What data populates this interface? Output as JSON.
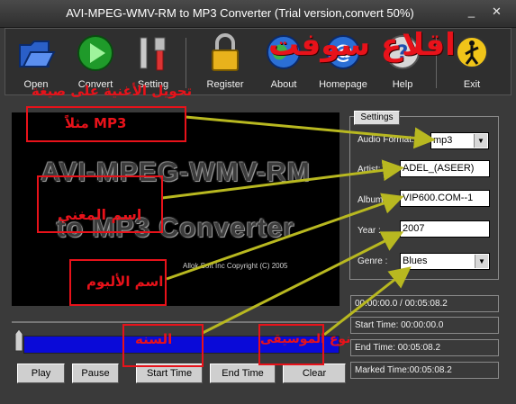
{
  "window": {
    "title": "AVI-MPEG-WMV-RM to MP3 Converter (Trial version,convert 50%)",
    "minimize": "_",
    "close": "✕"
  },
  "toolbar": {
    "items": [
      {
        "label": "Open",
        "icon": "folder-icon"
      },
      {
        "label": "Convert",
        "icon": "play-circle-icon"
      },
      {
        "label": "Setting",
        "icon": "tools-icon"
      },
      {
        "label": "Register",
        "icon": "lock-icon"
      },
      {
        "label": "About",
        "icon": "globe-icon"
      },
      {
        "label": "Homepage",
        "icon": "at-globe-icon"
      },
      {
        "label": "Help",
        "icon": "help-icon"
      },
      {
        "label": "Exit",
        "icon": "exit-icon"
      }
    ]
  },
  "preview": {
    "line1": "AVI-MPEG-WMV-RM",
    "line2": "to MP3 Converter",
    "copyright": "Allok Soft Inc Copyright (C) 2005"
  },
  "player": {
    "play": "Play",
    "pause": "Pause",
    "start_time": "Start Time",
    "end_time": "End Time",
    "clear": "Clear"
  },
  "settings": {
    "tab": "Settings",
    "audio_format_label": "Audio Format:",
    "audio_format_value": "mp3",
    "artist_label": "Artist:",
    "artist_value": "ADEL_(ASEER)",
    "album_label": "Album :",
    "album_value": "VIP600.COM--1",
    "year_label": "Year :",
    "year_value": "2007",
    "genre_label": "Genre :",
    "genre_value": "Blues"
  },
  "times": {
    "position": "00:00:00.0 / 00:05:08.2",
    "start": "Start Time:  00:00:00.0",
    "end": "End Time:  00:05:08.2",
    "marked": "Marked Time:00:05:08.2"
  },
  "annotations": {
    "watermark": "اقلاع سوفت",
    "convert_hint": "تحويل الأغنية على صيغة",
    "mp3_example": "مثلاً MP3",
    "singer": "اسم المغني",
    "album": "اسم الألبوم",
    "year": "السنه",
    "genre": "نوع الموسيقى"
  },
  "colors": {
    "annotation_red": "#e8121a",
    "arrow_olive": "#b8b820",
    "progress_blue": "#0a0ad8"
  }
}
